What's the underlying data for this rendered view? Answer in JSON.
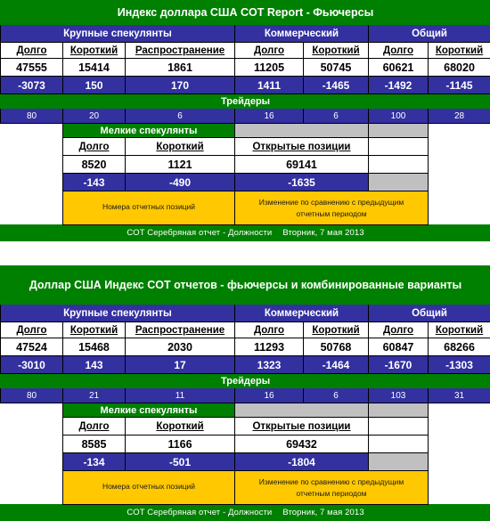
{
  "colors": {
    "green": "#008000",
    "blue": "#3330A0",
    "yellow": "#FFC800",
    "gray": "#C0C0C0",
    "white": "#FFFFFF",
    "black": "#000000"
  },
  "labels": {
    "large_specs": "Крупные спекулянты",
    "commercial": "Коммерческий",
    "total": "Общий",
    "long": "Долго",
    "short": "Короткий",
    "spreading": "Распространение",
    "traders": "Трейдеры",
    "small_specs": "Мелкие спекулянты",
    "open_interest": "Открытые позиции",
    "legend_left": "Номера отчетных позиций",
    "legend_right_line1": "Изменение по сравнению с предыдущим",
    "legend_right_line2": "отчетным периодом",
    "footer_text": "COT Серебряная отчет - Должности",
    "footer_date": "Вторник, 7 мая 2013"
  },
  "reports": [
    {
      "title": "Индекс доллара США COT Report - Фьючерсы",
      "title_lines": 1,
      "positions": {
        "large_long": "47555",
        "large_short": "15414",
        "large_spread": "1861",
        "comm_long": "11205",
        "comm_short": "50745",
        "total_long": "60621",
        "total_short": "68020"
      },
      "changes": {
        "large_long": "-3073",
        "large_short": "150",
        "large_spread": "170",
        "comm_long": "1411",
        "comm_short": "-1465",
        "total_long": "-1492",
        "total_short": "-1145"
      },
      "traders": {
        "large_long": "80",
        "large_short": "20",
        "large_spread": "6",
        "comm_long": "16",
        "comm_short": "6",
        "total_long": "100",
        "total_short": "28"
      },
      "small": {
        "long": "8520",
        "short": "1121",
        "open_interest": "69141",
        "long_change": "-143",
        "short_change": "-490",
        "oi_change": "-1635"
      }
    },
    {
      "title": "Доллар США Индекс COT отчетов - фьючерсы и комбинированные варианты",
      "title_lines": 2,
      "positions": {
        "large_long": "47524",
        "large_short": "15468",
        "large_spread": "2030",
        "comm_long": "11293",
        "comm_short": "50768",
        "total_long": "60847",
        "total_short": "68266"
      },
      "changes": {
        "large_long": "-3010",
        "large_short": "143",
        "large_spread": "17",
        "comm_long": "1323",
        "comm_short": "-1464",
        "total_long": "-1670",
        "total_short": "-1303"
      },
      "traders": {
        "large_long": "80",
        "large_short": "21",
        "large_spread": "11",
        "comm_long": "16",
        "comm_short": "6",
        "total_long": "103",
        "total_short": "31"
      },
      "small": {
        "long": "8585",
        "short": "1166",
        "open_interest": "69432",
        "long_change": "-134",
        "short_change": "-501",
        "oi_change": "-1804"
      }
    }
  ]
}
